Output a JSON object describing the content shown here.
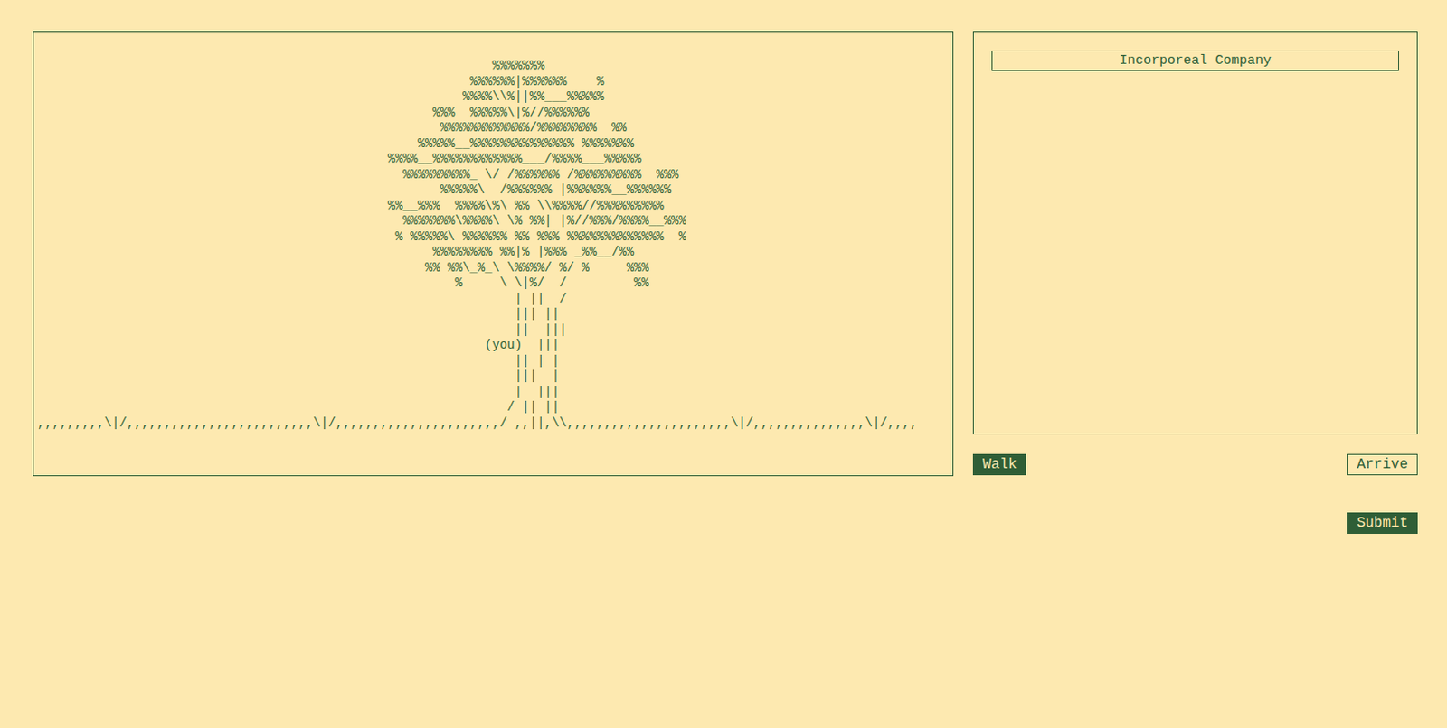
{
  "scene": {
    "art": [
      "                                                             %%%%%%%",
      "                                                          %%%%%%|%%%%%%    %",
      "                                                         %%%%\\\\%||%%___%%%%%",
      "                                                     %%%  %%%%%\\|%//%%%%%%",
      "                                                      %%%%%%%%%%%%/%%%%%%%%  %%",
      "                                                   %%%%%__%%%%%%%%%%%%%% %%%%%%%",
      "                                               %%%%__%%%%%%%%%%%%___/%%%%___%%%%%",
      "                                                 %%%%%%%%%_ \\/ /%%%%%% /%%%%%%%%%  %%%",
      "                                                      %%%%%\\  /%%%%%% |%%%%%%__%%%%%%",
      "                                               %%__%%%  %%%%\\%\\ %% \\\\%%%%//%%%%%%%%%",
      "                                                 %%%%%%%\\%%%%\\ \\% %%| |%//%%%/%%%%__%%%",
      "                                                % %%%%%\\ %%%%%% %% %%% %%%%%%%%%%%%%  %",
      "                                                     %%%%%%%% %%|% |%%% _%%__/%%",
      "                                                    %% %%\\_%_\\ \\%%%%/ %/ %     %%%",
      "                                                        %     \\ \\|%/  /         %%",
      "                                                                | ||  /",
      "                                                                ||| ||",
      "                                                                ||  |||",
      "                                                            (you)  |||",
      "                                                                || | |",
      "                                                                |||  |",
      "                                                                |  |||",
      "                                                               / || ||",
      ",,,,,,,,,\\|/,,,,,,,,,,,,,,,,,,,,,,,,,\\|/,,,,,,,,,,,,,,,,,,,,,,/ ,,||,\\\\,,,,,,,,,,,,,,,,,,,,,,\\|/,,,,,,,,,,,,,,,\\|/,,,,"
    ]
  },
  "party": [
    {
      "name": "Incorporeal Company"
    }
  ],
  "actions": [
    {
      "label": "Walk",
      "selected": true
    },
    {
      "label": "Arrive",
      "selected": false
    }
  ],
  "submit": {
    "label": "Submit"
  }
}
